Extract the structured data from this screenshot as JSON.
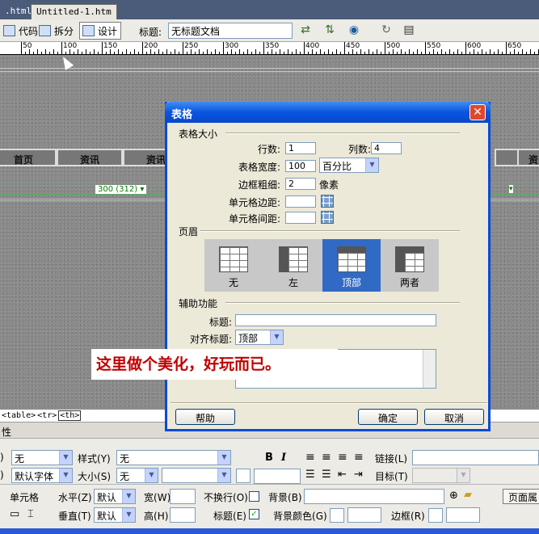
{
  "tabs": [
    ".html",
    "Untitled-1.htm"
  ],
  "toolbar": {
    "code": "代码",
    "split": "拆分",
    "design": "设计",
    "title_label": "标题:",
    "title_value": "无标题文档"
  },
  "ruler": [
    "50",
    "100",
    "150",
    "200",
    "250",
    "300",
    "350",
    "400",
    "450",
    "500",
    "550",
    "600",
    "650"
  ],
  "canvas": {
    "nav": [
      "首页",
      "资讯",
      "资讯",
      "资"
    ],
    "dimension": "300 (312) ▾"
  },
  "tagbar": [
    "<table>",
    "<tr>",
    "<th>"
  ],
  "props": {
    "header": "性",
    "format_value": "无",
    "style_label": "样式",
    "style_key": "(Y)",
    "style_value": "无",
    "font_value": "默认字体",
    "size_label": "大小",
    "size_key": "(S)",
    "size_value": "无",
    "bold": "B",
    "italic": "I",
    "link_label": "链接",
    "link_key": "(L)",
    "target_label": "目标",
    "target_key": "(T)",
    "cell_label": "单元格",
    "horz_label": "水平",
    "horz_key": "(Z)",
    "horz_value": "默认",
    "vert_label": "垂直",
    "vert_key": "(T)",
    "vert_value": "默认",
    "width_label": "宽",
    "width_key": "(W)",
    "height_label": "高",
    "height_key": "(H)",
    "nowrap_label": "不换行",
    "nowrap_key": "(O)",
    "header_label": "标题",
    "header_key": "(E)",
    "bg_label": "背景",
    "bg_key": "(B)",
    "bgcolor_label": "背景颜色",
    "bgcolor_key": "(G)",
    "border_label": "边框",
    "border_key": "(R)",
    "page_button": "页面属"
  },
  "dialog": {
    "title": "表格",
    "section_size": "表格大小",
    "rows_label": "行数:",
    "rows_value": "1",
    "cols_label": "列数:",
    "cols_value": "4",
    "width_label": "表格宽度:",
    "width_value": "100",
    "width_unit": "百分比",
    "border_label": "边框粗细:",
    "border_value": "2",
    "border_unit": "像素",
    "padding_label": "单元格边距:",
    "spacing_label": "单元格间距:",
    "section_header": "页眉",
    "header_options": [
      "无",
      "左",
      "顶部",
      "两者"
    ],
    "section_access": "辅助功能",
    "caption_label": "标题:",
    "align_label": "对齐标题:",
    "align_value": "顶部",
    "help": "帮助",
    "ok": "确定",
    "cancel": "取消"
  },
  "annotation": "这里做个美化，好玩而已。"
}
